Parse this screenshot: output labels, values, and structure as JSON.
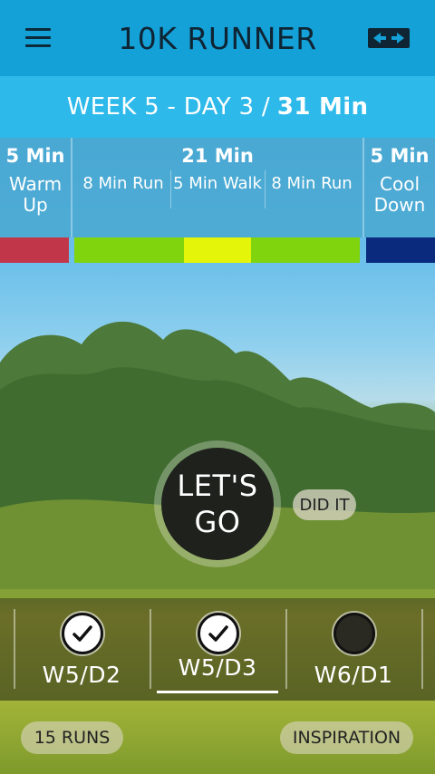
{
  "header": {
    "title": "10K RUNNER",
    "menu_icon": "hamburger-icon",
    "share_icon": "share-arrows-icon"
  },
  "week": {
    "label": "WEEK 5 - DAY 3 / ",
    "total": "31 Min"
  },
  "segments": {
    "warmup": {
      "duration": "5 Min",
      "label": "Warm Up"
    },
    "main": {
      "duration": "21 Min",
      "parts": [
        {
          "label": "8 Min Run"
        },
        {
          "label": "5 Min Walk"
        },
        {
          "label": "8 Min Run"
        }
      ]
    },
    "cooldown": {
      "duration": "5 Min",
      "label": "Cool Down"
    }
  },
  "colors": {
    "warmup": "#c2364a",
    "run": "#7fd40e",
    "walk": "#e4f50a",
    "cooldown": "#0a2a7e",
    "header": "#14a1d8"
  },
  "go_button": {
    "line1": "LET'S",
    "line2": "GO"
  },
  "did_it_label": "DID IT",
  "days": [
    {
      "label": "W5/D2",
      "status": "done"
    },
    {
      "label": "W5/D3",
      "status": "done",
      "selected": true
    },
    {
      "label": "W6/D1",
      "status": "todo"
    }
  ],
  "footer": {
    "runs_label": "15 RUNS",
    "inspiration_label": "INSPIRATION"
  }
}
